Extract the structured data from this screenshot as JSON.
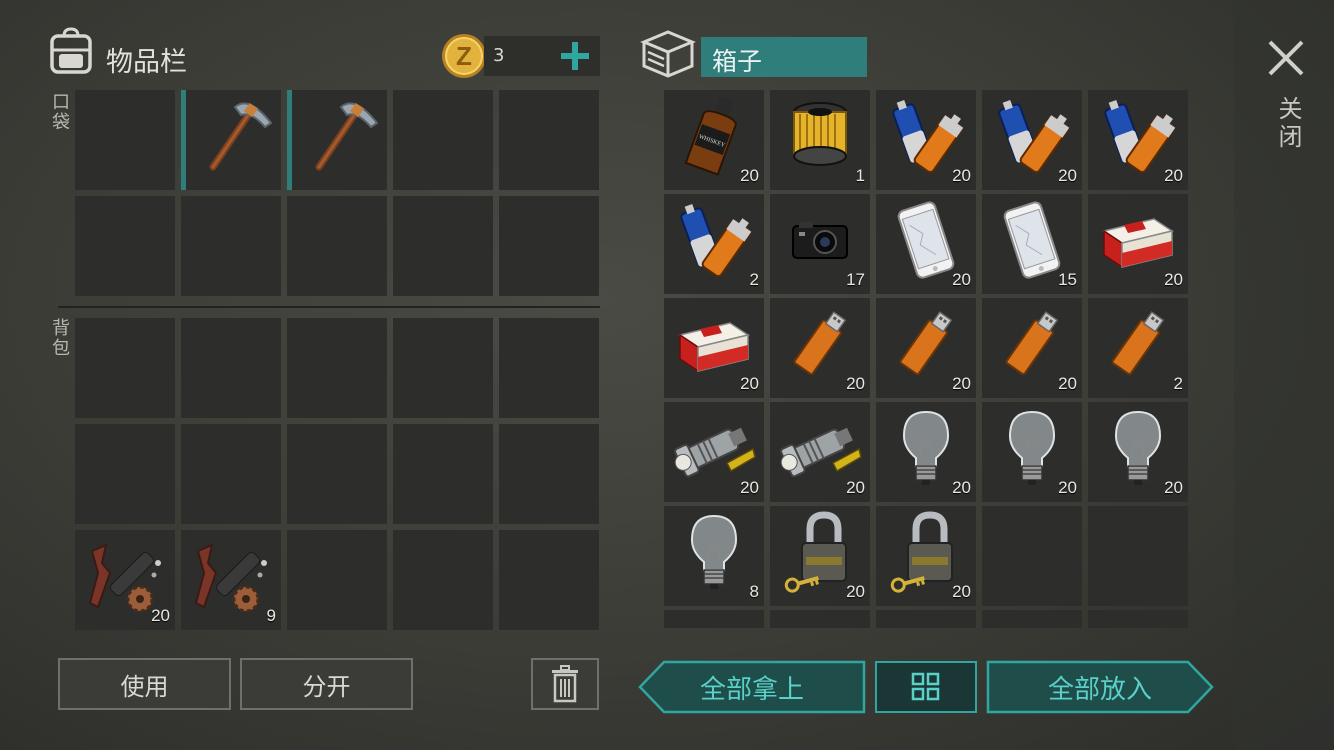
{
  "inventory": {
    "title": "物品栏",
    "coins": "3",
    "pocket_label": "口袋",
    "backpack_label": "背包",
    "pocket_slots": [
      {
        "item": "",
        "count": ""
      },
      {
        "item": "pickaxe",
        "count": ""
      },
      {
        "item": "pickaxe",
        "count": ""
      },
      {
        "item": "",
        "count": ""
      },
      {
        "item": "",
        "count": ""
      },
      {
        "item": "",
        "count": ""
      },
      {
        "item": "",
        "count": ""
      },
      {
        "item": "",
        "count": ""
      },
      {
        "item": "",
        "count": ""
      },
      {
        "item": "",
        "count": ""
      }
    ],
    "backpack_slots": [
      {
        "item": "",
        "count": ""
      },
      {
        "item": "",
        "count": ""
      },
      {
        "item": "",
        "count": ""
      },
      {
        "item": "",
        "count": ""
      },
      {
        "item": "",
        "count": ""
      },
      {
        "item": "",
        "count": ""
      },
      {
        "item": "",
        "count": ""
      },
      {
        "item": "",
        "count": ""
      },
      {
        "item": "",
        "count": ""
      },
      {
        "item": "",
        "count": ""
      },
      {
        "item": "weapon-parts",
        "count": "20"
      },
      {
        "item": "weapon-parts",
        "count": "9"
      },
      {
        "item": "",
        "count": ""
      },
      {
        "item": "",
        "count": ""
      },
      {
        "item": "",
        "count": ""
      }
    ],
    "use_label": "使用",
    "split_label": "分开"
  },
  "box": {
    "title": "箱子",
    "slots": [
      {
        "item": "whiskey",
        "count": "20"
      },
      {
        "item": "air-filter",
        "count": "1"
      },
      {
        "item": "batteries",
        "count": "20"
      },
      {
        "item": "batteries",
        "count": "20"
      },
      {
        "item": "batteries",
        "count": "20"
      },
      {
        "item": "batteries",
        "count": "2"
      },
      {
        "item": "camera",
        "count": "17"
      },
      {
        "item": "smartphone",
        "count": "20"
      },
      {
        "item": "smartphone",
        "count": "15"
      },
      {
        "item": "cigarettes",
        "count": "20"
      },
      {
        "item": "cigarettes",
        "count": "20"
      },
      {
        "item": "usb-drive",
        "count": "20"
      },
      {
        "item": "usb-drive",
        "count": "20"
      },
      {
        "item": "usb-drive",
        "count": "20"
      },
      {
        "item": "usb-drive",
        "count": "2"
      },
      {
        "item": "flashlight",
        "count": "20"
      },
      {
        "item": "flashlight",
        "count": "20"
      },
      {
        "item": "light-bulb",
        "count": "20"
      },
      {
        "item": "light-bulb",
        "count": "20"
      },
      {
        "item": "light-bulb",
        "count": "20"
      },
      {
        "item": "light-bulb",
        "count": "8"
      },
      {
        "item": "padlock",
        "count": "20"
      },
      {
        "item": "padlock",
        "count": "20"
      },
      {
        "item": "",
        "count": ""
      },
      {
        "item": "",
        "count": ""
      }
    ],
    "take_all_label": "全部拿上",
    "put_all_label": "全部放入"
  },
  "close_label": "关闭",
  "colors": {
    "accent": "#2f7e7c",
    "accent_text": "#5ad0c8",
    "slot": "#2d2e2b"
  }
}
